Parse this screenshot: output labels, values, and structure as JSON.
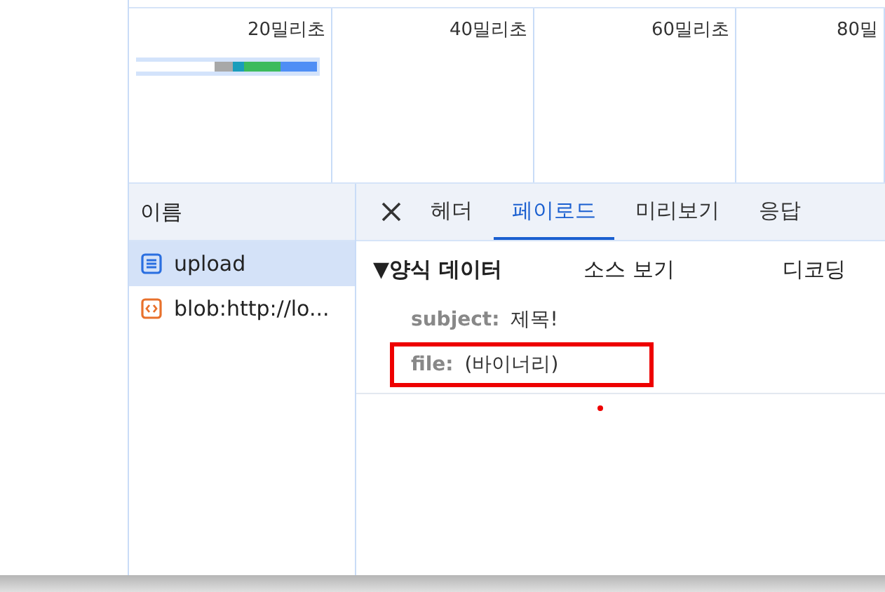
{
  "timeline": {
    "ticks": [
      "20밀리초",
      "40밀리초",
      "60밀리초",
      "80밀"
    ]
  },
  "requests": {
    "header": "이름",
    "items": [
      {
        "name": "upload",
        "kind": "document",
        "selected": true
      },
      {
        "name": "blob:http://lo...",
        "kind": "script",
        "selected": false
      }
    ]
  },
  "detail_tabs": [
    {
      "label": "헤더",
      "selected": false
    },
    {
      "label": "페이로드",
      "selected": true
    },
    {
      "label": "미리보기",
      "selected": false
    },
    {
      "label": "응답",
      "selected": false
    }
  ],
  "form_data": {
    "title": "▼양식 데이터",
    "view_source": "소스 보기",
    "decoded": "디코딩",
    "fields": [
      {
        "key": "subject:",
        "value": "제목!",
        "highlighted": false
      },
      {
        "key": "file:",
        "value": "(바이너리)",
        "highlighted": true
      }
    ]
  }
}
